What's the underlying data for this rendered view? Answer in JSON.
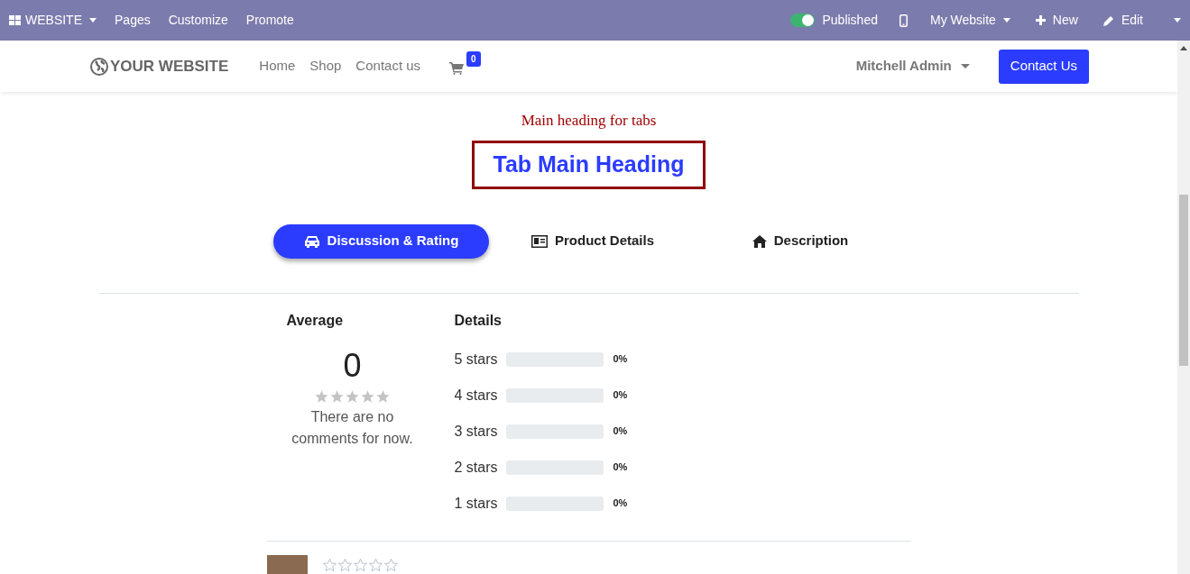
{
  "admin_bar": {
    "app_menu": "WEBSITE",
    "menu": [
      "Pages",
      "Customize",
      "Promote"
    ],
    "published": {
      "label": "Published",
      "on": true
    },
    "website_menu": "My Website",
    "new_button": "New",
    "edit_button": "Edit"
  },
  "navbar": {
    "logo": "YOUR WEBSITE",
    "links": [
      "Home",
      "Shop",
      "Contact us"
    ],
    "cart_count": "0",
    "user": "Mitchell Admin",
    "cta": "Contact Us"
  },
  "caption": "Main heading for tabs",
  "heading": "Tab Main Heading",
  "tabs": [
    {
      "label": "Discussion & Rating",
      "kind": "car",
      "selected": true
    },
    {
      "label": "Product Details",
      "kind": "card",
      "selected": false
    },
    {
      "label": "Description",
      "kind": "home",
      "selected": false
    }
  ],
  "rating": {
    "average_title": "Average",
    "average": "0",
    "stars": 0,
    "empty_message": "There are no comments for now.",
    "details_title": "Details",
    "rows": [
      {
        "label": "5 stars",
        "level": 0,
        "percent": "0%"
      },
      {
        "label": "4 stars",
        "level": 0,
        "percent": "0%"
      },
      {
        "label": "3 stars",
        "level": 0,
        "percent": "0%"
      },
      {
        "label": "2 stars",
        "level": 0,
        "percent": "0%"
      },
      {
        "label": "1 stars",
        "level": 0,
        "percent": "0%"
      }
    ]
  },
  "review": {
    "stars": 0
  }
}
